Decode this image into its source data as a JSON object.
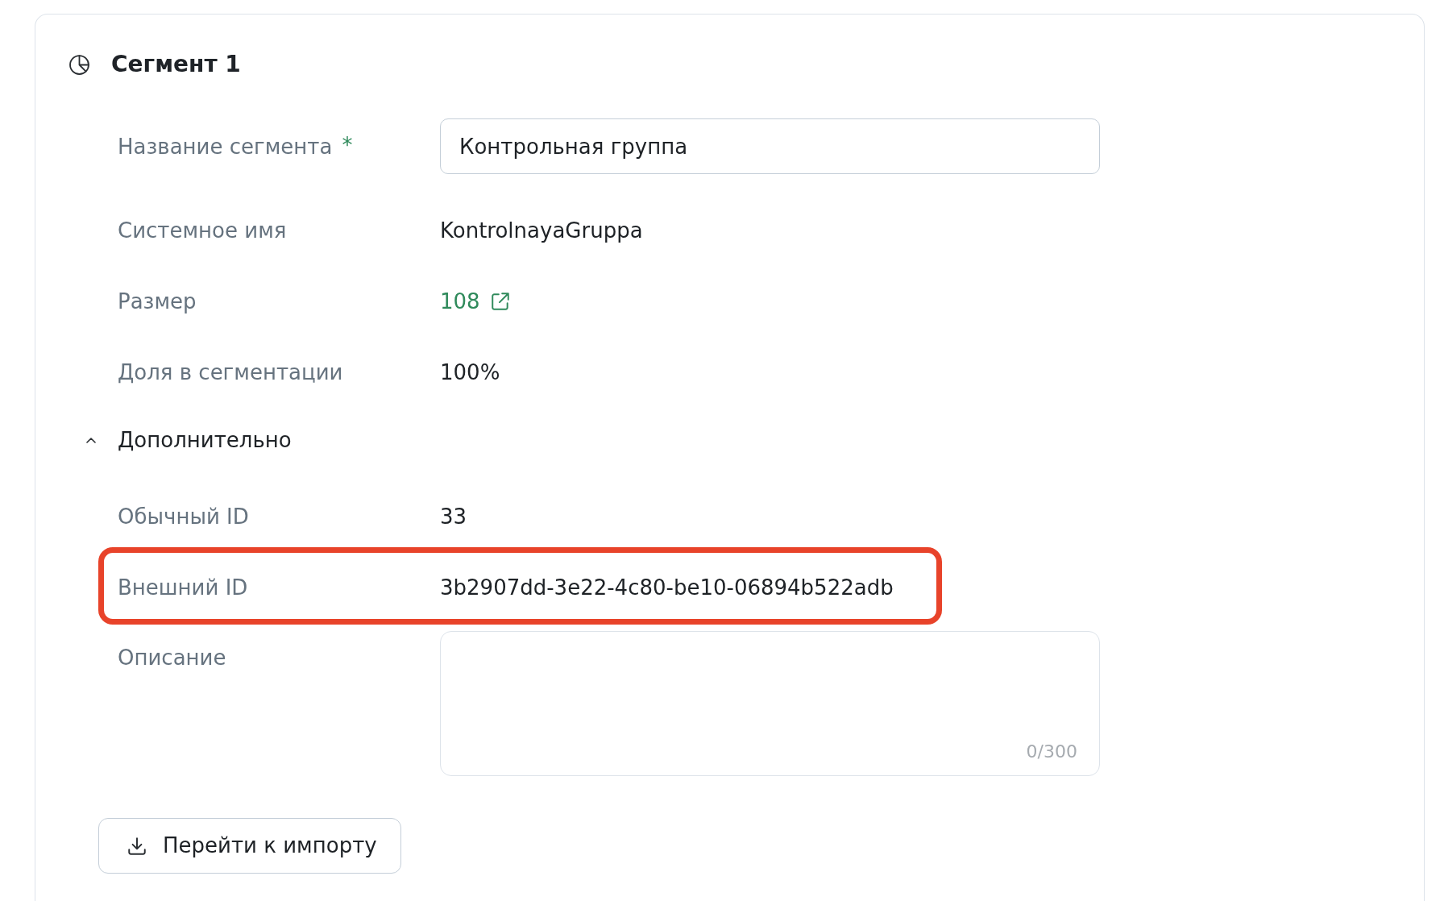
{
  "segment": {
    "title": "Сегмент 1"
  },
  "fields": [
    {
      "kind": "input",
      "label": "Название сегмента",
      "required_mark": "*",
      "value": "Контрольная группа",
      "highlighted": false
    },
    {
      "kind": "text",
      "label": "Системное имя",
      "value": "KontrolnayaGruppa",
      "highlighted": false
    },
    {
      "kind": "link",
      "label": "Размер",
      "value": "108",
      "highlighted": false
    },
    {
      "kind": "text",
      "label": "Доля в сегментации",
      "value": "100%",
      "highlighted": false
    }
  ],
  "advanced": {
    "label": "Дополнительно",
    "expanded": true,
    "fields": [
      {
        "kind": "text",
        "label": "Обычный ID",
        "value": "33",
        "highlighted": false
      },
      {
        "kind": "text",
        "label": "Внешний ID",
        "value": "3b2907dd-3e22-4c80-be10-06894b522adb",
        "highlighted": true
      },
      {
        "kind": "textarea",
        "label": "Описание",
        "counter": "0/300",
        "highlighted": false
      }
    ]
  },
  "import_button": {
    "label": "Перейти к импорту"
  }
}
